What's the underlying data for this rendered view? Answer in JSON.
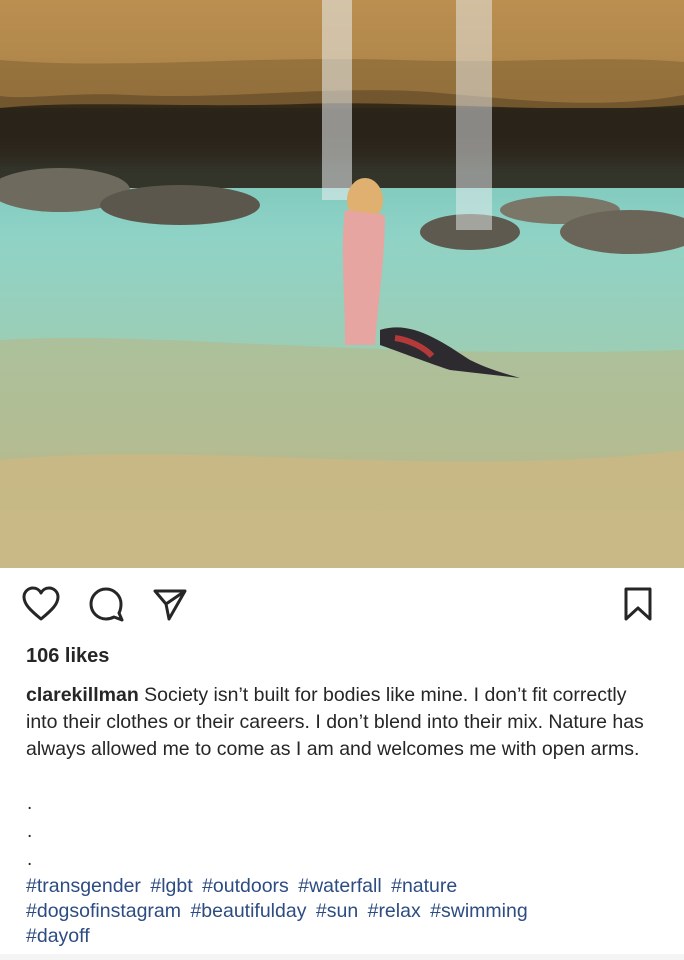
{
  "post": {
    "image_alt": "Person wading in a turquoise pool under a waterfall with a dog",
    "likes_text": "106 likes",
    "username": "clarekillman",
    "caption": "Society isn’t built for bodies like mine. I don’t fit correctly into their clothes or their careers. I don’t blend into their mix. Nature has always allowed me to come as I am and welcomes me with open arms.",
    "dots": [
      ".",
      ".",
      "."
    ],
    "hashtags": [
      "#transgender",
      "#lgbt",
      "#outdoors",
      "#waterfall",
      "#nature",
      "#dogsofinstagram",
      "#beautifulday",
      "#sun",
      "#relax",
      "#swimming",
      "#dayoff"
    ]
  },
  "actions": {
    "like_icon": "heart-icon",
    "comment_icon": "comment-icon",
    "share_icon": "send-icon",
    "save_icon": "bookmark-icon"
  },
  "colors": {
    "text": "#262626",
    "hashtag": "#2d4c82",
    "water": "#8fd3c6"
  }
}
